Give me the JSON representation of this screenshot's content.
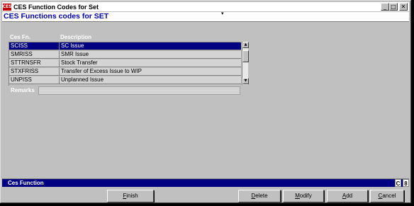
{
  "window": {
    "title": "CES Function Codes for Set",
    "icon_text": "CES",
    "buttons": {
      "minimize": "_",
      "maximize": "□",
      "close": "✕"
    }
  },
  "subheader": {
    "title": "CES Functions codes for SET",
    "mark": "▾"
  },
  "grid": {
    "columns": [
      "Ces Fn.",
      "Description"
    ],
    "rows": [
      {
        "code": "SCISS",
        "description": "SC Issue",
        "selected": true
      },
      {
        "code": "SMRISS",
        "description": "SMR Issue",
        "selected": false
      },
      {
        "code": "STTRNSFR",
        "description": "Stock Transfer",
        "selected": false
      },
      {
        "code": "STXFRISS",
        "description": "Transfer of Excess Issue to WIP",
        "selected": false
      },
      {
        "code": "UNPISS",
        "description": "Unplanned Issue",
        "selected": false
      }
    ],
    "scroll_up": "▲",
    "scroll_down": "▼"
  },
  "remarks": {
    "label": "Remarks",
    "value": ""
  },
  "statusbar": {
    "text": "Ces Function",
    "box1": "C",
    "box2": "8"
  },
  "buttons": {
    "finish": {
      "first": "F",
      "rest": "inish"
    },
    "delete": {
      "first": "D",
      "rest": "elete"
    },
    "modify": {
      "first": "M",
      "rest": "odify"
    },
    "add": {
      "first": "A",
      "rest": "dd"
    },
    "cancel": {
      "first": "C",
      "rest": "ancel"
    }
  },
  "colors": {
    "selection": "#000080",
    "accent": "#0000a8",
    "window_bg": "#c0c0c0"
  }
}
